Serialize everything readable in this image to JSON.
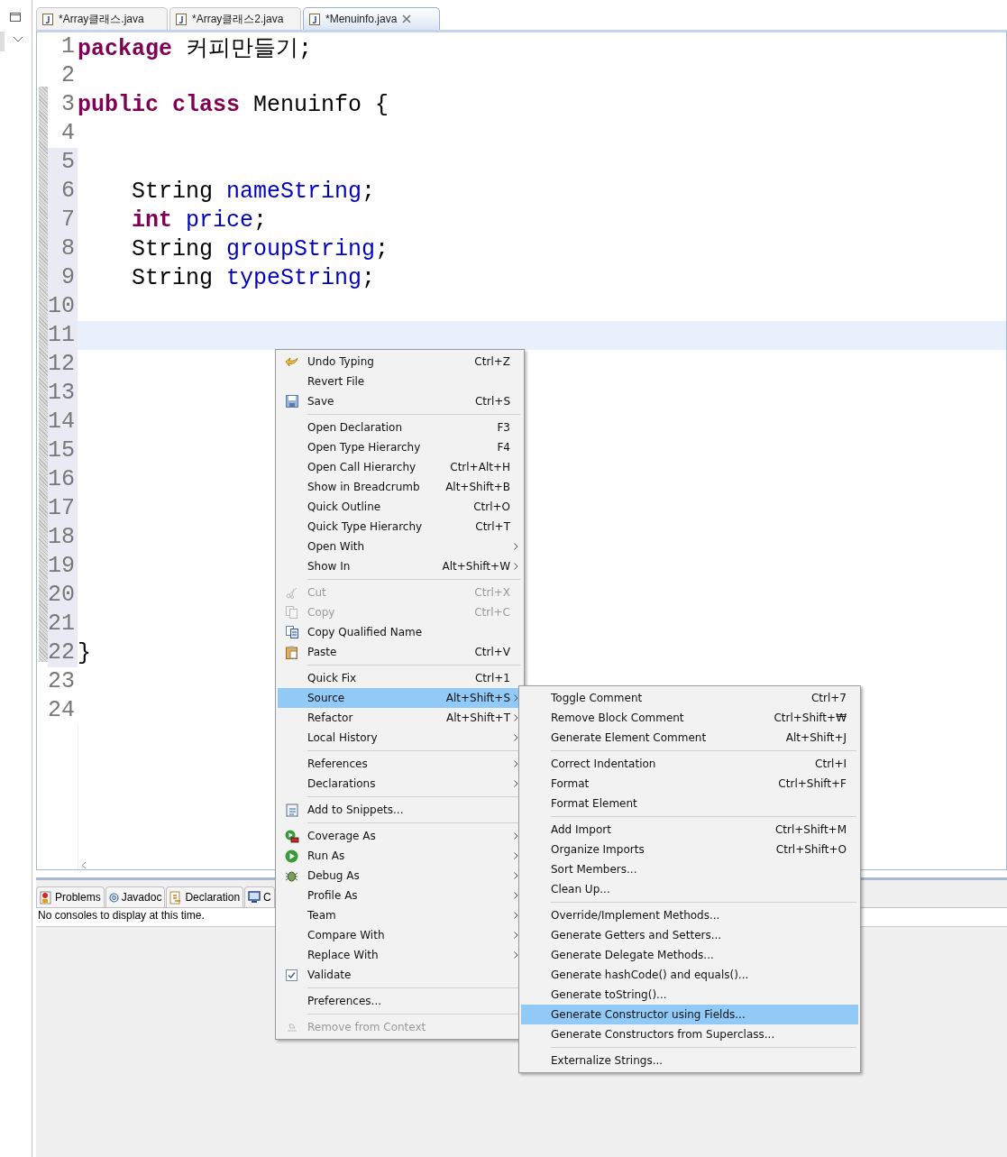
{
  "editor_tabs": [
    {
      "label": "*Array클래스.java",
      "selected": false,
      "closable": false
    },
    {
      "label": "*Array클래스2.java",
      "selected": false,
      "closable": false
    },
    {
      "label": "*Menuinfo.java",
      "selected": true,
      "closable": true
    }
  ],
  "code_lines": [
    {
      "number": "1",
      "tokens": [
        {
          "text": "package",
          "kind": "keyword"
        },
        {
          "text": " 커피만들기;",
          "kind": "plain"
        }
      ]
    },
    {
      "number": "2"
    },
    {
      "number": "3",
      "tokens": [
        {
          "text": "public",
          "kind": "keyword"
        },
        {
          "text": " class",
          "kind": "keyword"
        },
        {
          "text": " Menuinfo {",
          "kind": "plain"
        }
      ]
    },
    {
      "number": "4"
    },
    {
      "number": "5"
    },
    {
      "number": "6",
      "tokens": [
        {
          "text": "    String",
          "kind": "plain"
        },
        {
          "text": " nameString",
          "kind": "field"
        },
        {
          "text": ";",
          "kind": "plain"
        }
      ]
    },
    {
      "number": "7",
      "tokens": [
        {
          "text": "    int",
          "kind": "keyword"
        },
        {
          "text": " price",
          "kind": "field"
        },
        {
          "text": ";",
          "kind": "plain"
        }
      ]
    },
    {
      "number": "8",
      "tokens": [
        {
          "text": "    String",
          "kind": "plain"
        },
        {
          "text": " groupString",
          "kind": "field"
        },
        {
          "text": ";",
          "kind": "plain"
        }
      ]
    },
    {
      "number": "9",
      "tokens": [
        {
          "text": "    String",
          "kind": "plain"
        },
        {
          "text": " typeString",
          "kind": "field"
        },
        {
          "text": ";",
          "kind": "plain"
        }
      ]
    },
    {
      "number": "10"
    },
    {
      "number": "11",
      "current": true
    },
    {
      "number": "12"
    },
    {
      "number": "13"
    },
    {
      "number": "14"
    },
    {
      "number": "15"
    },
    {
      "number": "16"
    },
    {
      "number": "17"
    },
    {
      "number": "18"
    },
    {
      "number": "19"
    },
    {
      "number": "20"
    },
    {
      "number": "21"
    },
    {
      "number": "22",
      "tokens": [
        {
          "text": "}",
          "kind": "plain"
        }
      ]
    },
    {
      "number": "23"
    },
    {
      "number": "24"
    }
  ],
  "bottom_tabs": [
    {
      "label": "Problems"
    },
    {
      "label": "Javadoc"
    },
    {
      "label": "Declaration"
    },
    {
      "label": "C"
    }
  ],
  "console_message": "No consoles to display at this time.",
  "context_menu": [
    {
      "kind": "undo",
      "label": "Undo Typing",
      "shortcut": "Ctrl+Z",
      "disabled": false,
      "selected": false
    },
    {
      "kind": "plain",
      "label": "Revert File",
      "disabled": false,
      "selected": false
    },
    {
      "kind": "save",
      "label": "Save",
      "shortcut": "Ctrl+S",
      "disabled": false,
      "selected": false
    },
    {
      "kind": "separator"
    },
    {
      "kind": "plain",
      "label": "Open Declaration",
      "shortcut": "F3",
      "disabled": false,
      "selected": false
    },
    {
      "kind": "plain",
      "label": "Open Type Hierarchy",
      "shortcut": "F4",
      "disabled": false,
      "selected": false
    },
    {
      "kind": "plain",
      "label": "Open Call Hierarchy",
      "shortcut": "Ctrl+Alt+H",
      "disabled": false,
      "selected": false
    },
    {
      "kind": "plain",
      "label": "Show in Breadcrumb",
      "shortcut": "Alt+Shift+B",
      "disabled": false,
      "selected": false
    },
    {
      "kind": "plain",
      "label": "Quick Outline",
      "shortcut": "Ctrl+O",
      "disabled": false,
      "selected": false
    },
    {
      "kind": "plain",
      "label": "Quick Type Hierarchy",
      "shortcut": "Ctrl+T",
      "disabled": false,
      "selected": false
    },
    {
      "kind": "plain",
      "label": "Open With",
      "submenu": true,
      "disabled": false,
      "selected": false
    },
    {
      "kind": "plain",
      "label": "Show In",
      "shortcut": "Alt+Shift+W",
      "submenu": true,
      "disabled": false,
      "selected": false
    },
    {
      "kind": "separator"
    },
    {
      "kind": "cut",
      "label": "Cut",
      "shortcut": "Ctrl+X",
      "disabled": true,
      "selected": false
    },
    {
      "kind": "copy",
      "label": "Copy",
      "shortcut": "Ctrl+C",
      "disabled": true,
      "selected": false
    },
    {
      "kind": "copy_name",
      "label": "Copy Qualified Name",
      "disabled": false,
      "selected": false
    },
    {
      "kind": "paste",
      "label": "Paste",
      "shortcut": "Ctrl+V",
      "disabled": false,
      "selected": false
    },
    {
      "kind": "separator"
    },
    {
      "kind": "plain",
      "label": "Quick Fix",
      "shortcut": "Ctrl+1",
      "disabled": false,
      "selected": false
    },
    {
      "kind": "plain",
      "label": "Source",
      "shortcut": "Alt+Shift+S",
      "submenu": true,
      "disabled": false,
      "selected": true
    },
    {
      "kind": "plain",
      "label": "Refactor",
      "shortcut": "Alt+Shift+T",
      "submenu": true,
      "disabled": false,
      "selected": false
    },
    {
      "kind": "plain",
      "label": "Local History",
      "submenu": true,
      "disabled": false,
      "selected": false
    },
    {
      "kind": "separator"
    },
    {
      "kind": "plain",
      "label": "References",
      "submenu": true,
      "disabled": false,
      "selected": false
    },
    {
      "kind": "plain",
      "label": "Declarations",
      "submenu": true,
      "disabled": false,
      "selected": false
    },
    {
      "kind": "separator"
    },
    {
      "kind": "snippets",
      "label": "Add to Snippets...",
      "disabled": false,
      "selected": false
    },
    {
      "kind": "separator"
    },
    {
      "kind": "coverage",
      "label": "Coverage As",
      "submenu": true,
      "disabled": false,
      "selected": false
    },
    {
      "kind": "run",
      "label": "Run As",
      "submenu": true,
      "disabled": false,
      "selected": false
    },
    {
      "kind": "debug",
      "label": "Debug As",
      "submenu": true,
      "disabled": false,
      "selected": false
    },
    {
      "kind": "plain",
      "label": "Profile As",
      "submenu": true,
      "disabled": false,
      "selected": false
    },
    {
      "kind": "plain",
      "label": "Team",
      "submenu": true,
      "disabled": false,
      "selected": false
    },
    {
      "kind": "plain",
      "label": "Compare With",
      "submenu": true,
      "disabled": false,
      "selected": false
    },
    {
      "kind": "plain",
      "label": "Replace With",
      "submenu": true,
      "disabled": false,
      "selected": false
    },
    {
      "kind": "checkbox",
      "label": "Validate",
      "checked": true,
      "disabled": false,
      "selected": false
    },
    {
      "kind": "separator"
    },
    {
      "kind": "plain",
      "label": "Preferences...",
      "disabled": false,
      "selected": false
    },
    {
      "kind": "separator"
    },
    {
      "kind": "remove",
      "label": "Remove from Context",
      "disabled": true,
      "selected": false
    }
  ],
  "source_submenu": [
    {
      "kind": "item",
      "label": "Toggle Comment",
      "shortcut": "Ctrl+7",
      "selected": false
    },
    {
      "kind": "item",
      "label": "Remove Block Comment",
      "shortcut": "Ctrl+Shift+₩",
      "selected": false
    },
    {
      "kind": "item",
      "label": "Generate Element Comment",
      "shortcut": "Alt+Shift+J",
      "selected": false
    },
    {
      "kind": "separator"
    },
    {
      "kind": "item",
      "label": "Correct Indentation",
      "shortcut": "Ctrl+I",
      "selected": false
    },
    {
      "kind": "item",
      "label": "Format",
      "shortcut": "Ctrl+Shift+F",
      "selected": false
    },
    {
      "kind": "item",
      "label": "Format Element",
      "selected": false
    },
    {
      "kind": "separator"
    },
    {
      "kind": "item",
      "label": "Add Import",
      "shortcut": "Ctrl+Shift+M",
      "selected": false
    },
    {
      "kind": "item",
      "label": "Organize Imports",
      "shortcut": "Ctrl+Shift+O",
      "selected": false
    },
    {
      "kind": "item",
      "label": "Sort Members...",
      "selected": false
    },
    {
      "kind": "item",
      "label": "Clean Up...",
      "selected": false
    },
    {
      "kind": "separator"
    },
    {
      "kind": "item",
      "label": "Override/Implement Methods...",
      "selected": false
    },
    {
      "kind": "item",
      "label": "Generate Getters and Setters...",
      "selected": false
    },
    {
      "kind": "item",
      "label": "Generate Delegate Methods...",
      "selected": false
    },
    {
      "kind": "item",
      "label": "Generate hashCode() and equals()...",
      "selected": false
    },
    {
      "kind": "item",
      "label": "Generate toString()...",
      "selected": false
    },
    {
      "kind": "item",
      "label": "Generate Constructor using Fields...",
      "selected": true
    },
    {
      "kind": "item",
      "label": "Generate Constructors from Superclass...",
      "selected": false
    },
    {
      "kind": "separator"
    },
    {
      "kind": "item",
      "label": "Externalize Strings...",
      "selected": false
    }
  ]
}
